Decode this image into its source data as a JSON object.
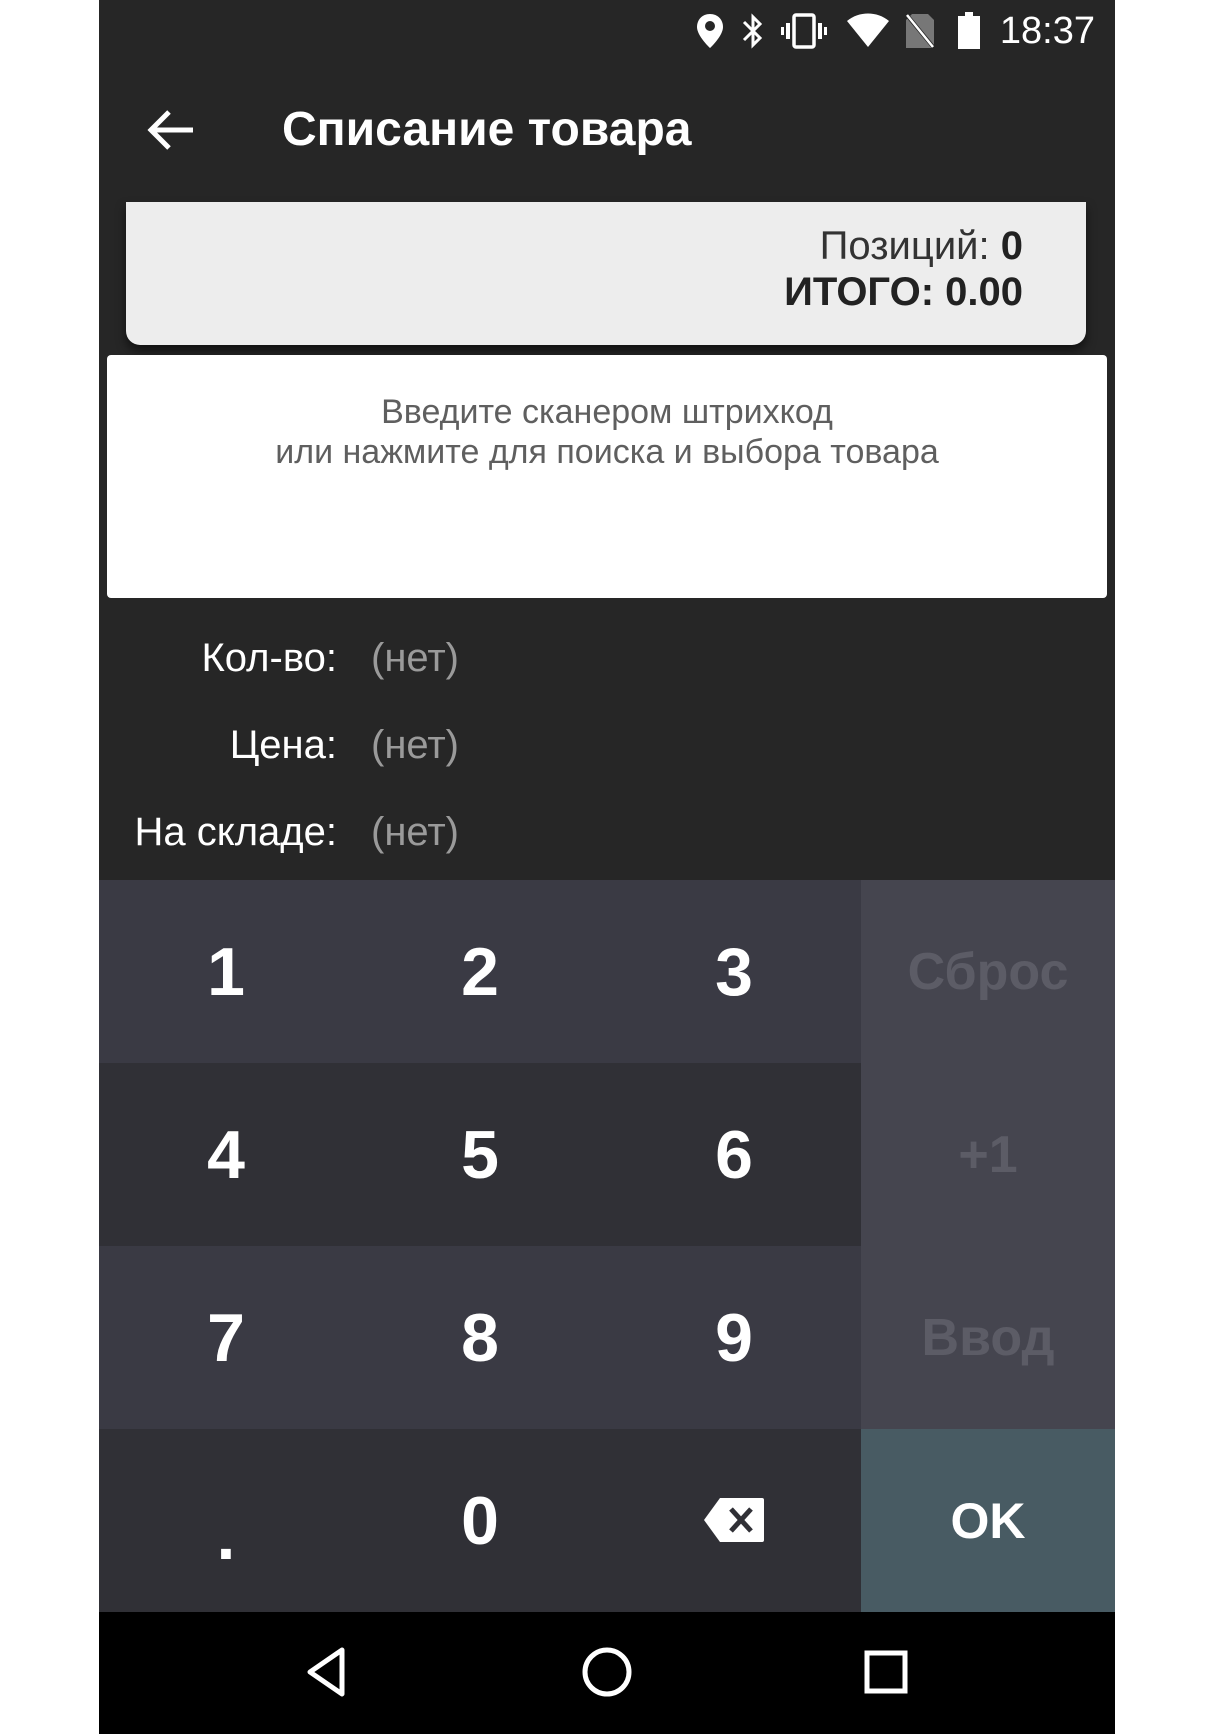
{
  "status_bar": {
    "time": "18:37",
    "icons": [
      "location-icon",
      "bluetooth-icon",
      "vibrate-icon",
      "wifi-icon",
      "no-sim-icon",
      "battery-icon"
    ]
  },
  "app_bar": {
    "title": "Списание товара",
    "back_icon": "arrow-back-icon"
  },
  "totals": {
    "positions_label": "Позиций:",
    "positions_value": "0",
    "total_label": "ИТОГО:",
    "total_value": "0.00"
  },
  "search": {
    "hint_line1": "Введите сканером штрихкод",
    "hint_line2": "или нажмите для поиска и выбора товара"
  },
  "info": {
    "qty_label": "Кол-во:",
    "qty_value": "(нет)",
    "price_label": "Цена:",
    "price_value": "(нет)",
    "stock_label": "На складе:",
    "stock_value": "(нет)"
  },
  "keypad": {
    "keys": [
      "1",
      "2",
      "3",
      "4",
      "5",
      "6",
      "7",
      "8",
      "9",
      ".",
      "0"
    ],
    "backspace_icon": "backspace-icon",
    "reset": "Сброс",
    "plus_one": "+1",
    "enter": "Ввод",
    "ok": "OK"
  },
  "nav_bar": {
    "icons": [
      "nav-back-icon",
      "nav-home-icon",
      "nav-recents-icon"
    ]
  },
  "colors": {
    "app_bg": "#262626",
    "card_bg": "#ededed",
    "key_row_a": "#3a3a44",
    "key_row_b": "#303036",
    "key_side": "#45454f",
    "ok_bg": "#485b63"
  }
}
